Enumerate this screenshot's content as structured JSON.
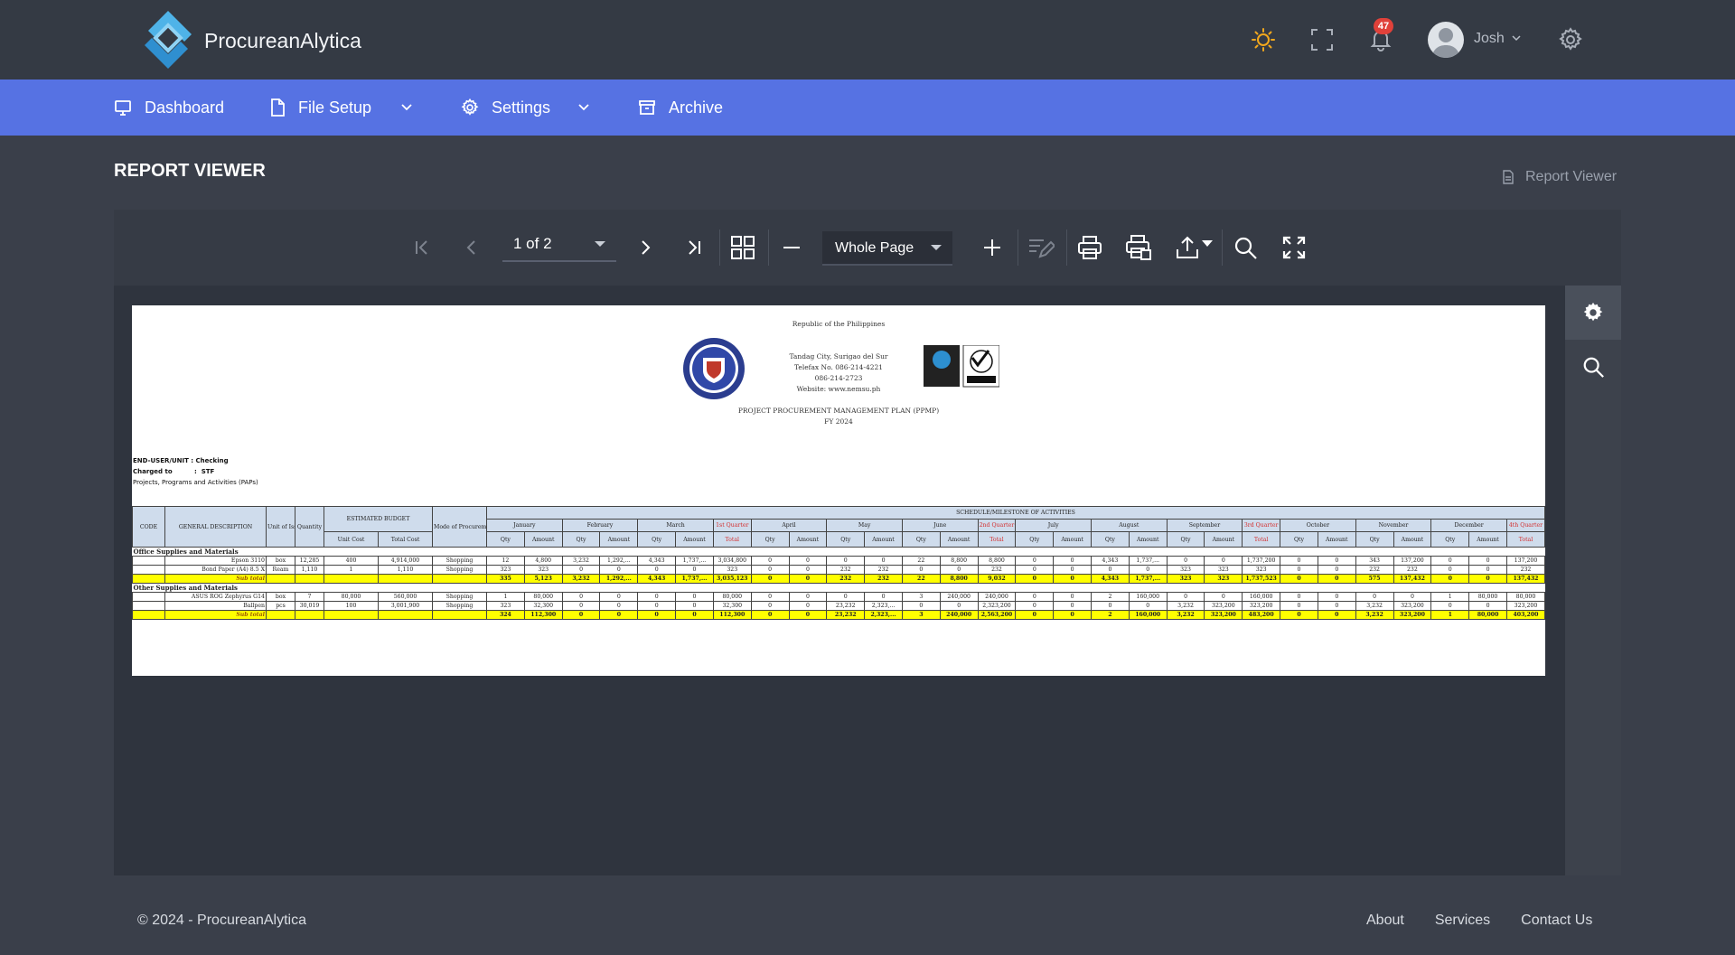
{
  "app": {
    "brand": "ProcureanAlytica"
  },
  "header": {
    "notifications_count": "47",
    "username": "Josh"
  },
  "nav": {
    "dashboard": "Dashboard",
    "file_setup": "File Setup",
    "settings": "Settings",
    "archive": "Archive"
  },
  "page": {
    "title": "REPORT VIEWER",
    "breadcrumb": "Report Viewer"
  },
  "toolbar": {
    "page_indicator": "1 of 2",
    "zoom_mode": "Whole Page"
  },
  "report": {
    "republic": "Republic of the Philippines",
    "address_line1": "Tandag City, Surigao del Sur",
    "address_line2": "Telefax No. 086-214-4221",
    "address_line3": "086-214-2723",
    "address_line4": "Website: www.nemsu.ph",
    "plan_title": "PROJECT PROCUREMENT MANAGEMENT PLAN (PPMP)",
    "fiscal_year": "FY 2024",
    "end_user": "END-USER/UNIT : Checking",
    "charged_to": "Charged to          :  STF",
    "paps": "Projects, Programs and Activities (PAPs)",
    "col_code": "CODE",
    "col_desc": "GENERAL DESCRIPTION",
    "col_unit": "Unit of Issue",
    "col_qty": "Quantity",
    "col_budget": "ESTIMATED BUDGET",
    "col_unit_cost": "Unit Cost",
    "col_total_cost": "Total Cost",
    "col_mode": "Mode of Procurement",
    "col_schedule": "SCHEDULE/MILESTONE OF ACTIVITIES",
    "months": [
      "January",
      "February",
      "March",
      "1st Quarter",
      "April",
      "May",
      "June",
      "2nd Quarter",
      "July",
      "August",
      "September",
      "3rd Quarter",
      "October",
      "November",
      "December",
      "4th Quarter"
    ],
    "qty_label": "Qty",
    "amount_label": "Amount",
    "total_label": "Total",
    "sections": [
      {
        "name": "Office Supplies and Materials",
        "rows": [
          [
            "",
            "Epson 3110",
            "box",
            "12,285",
            "400",
            "4,914,000",
            "Shopping",
            "12",
            "4,800",
            "3,232",
            "1,292,...",
            "4,343",
            "1,737,...",
            "3,034,800",
            "0",
            "0",
            "0",
            "0",
            "22",
            "8,800",
            "8,800",
            "0",
            "0",
            "4,343",
            "1,737,...",
            "0",
            "0",
            "1,737,200",
            "0",
            "0",
            "343",
            "137,200",
            "0",
            "0",
            "137,200"
          ],
          [
            "",
            "Bond Paper (A4) 8.5 X",
            "Ream",
            "1,110",
            "1",
            "1,110",
            "Shopping",
            "323",
            "323",
            "0",
            "0",
            "0",
            "0",
            "323",
            "0",
            "0",
            "232",
            "232",
            "0",
            "0",
            "232",
            "0",
            "0",
            "0",
            "0",
            "323",
            "323",
            "323",
            "0",
            "0",
            "232",
            "232",
            "0",
            "0",
            "232"
          ]
        ],
        "subtotal": [
          "Sub total",
          "",
          "",
          "",
          "",
          "",
          "335",
          "5,123",
          "3,232",
          "1,292,...",
          "4,343",
          "1,737,...",
          "3,035,123",
          "0",
          "0",
          "232",
          "232",
          "22",
          "8,800",
          "9,032",
          "0",
          "0",
          "4,343",
          "1,737,...",
          "323",
          "323",
          "1,737,523",
          "0",
          "0",
          "575",
          "137,432",
          "0",
          "0",
          "137,432"
        ]
      },
      {
        "name": "Other Supplies and Materials",
        "rows": [
          [
            "",
            "ASUS ROG Zephyrus G14",
            "box",
            "7",
            "80,000",
            "560,000",
            "Shopping",
            "1",
            "80,000",
            "0",
            "0",
            "0",
            "0",
            "80,000",
            "0",
            "0",
            "0",
            "0",
            "3",
            "240,000",
            "240,000",
            "0",
            "0",
            "2",
            "160,000",
            "0",
            "0",
            "160,000",
            "0",
            "0",
            "0",
            "0",
            "1",
            "80,000",
            "80,000"
          ],
          [
            "",
            "Ballpen",
            "pcs",
            "30,019",
            "100",
            "3,001,900",
            "Shopping",
            "323",
            "32,300",
            "0",
            "0",
            "0",
            "0",
            "32,300",
            "0",
            "0",
            "23,232",
            "2,323,...",
            "0",
            "0",
            "2,323,200",
            "0",
            "0",
            "0",
            "0",
            "3,232",
            "323,200",
            "323,200",
            "0",
            "0",
            "3,232",
            "323,200",
            "0",
            "0",
            "323,200"
          ]
        ],
        "subtotal": [
          "Sub total",
          "",
          "",
          "",
          "",
          "",
          "324",
          "112,300",
          "0",
          "0",
          "0",
          "0",
          "112,300",
          "0",
          "0",
          "23,232",
          "2,323,...",
          "3",
          "240,000",
          "2,563,200",
          "0",
          "0",
          "2",
          "160,000",
          "3,232",
          "323,200",
          "483,200",
          "0",
          "0",
          "3,232",
          "323,200",
          "1",
          "80,000",
          "403,200"
        ]
      }
    ]
  },
  "footer": {
    "copyright": "© 2024 - ProcureanAlytica",
    "links": [
      "About",
      "Services",
      "Contact Us"
    ]
  }
}
